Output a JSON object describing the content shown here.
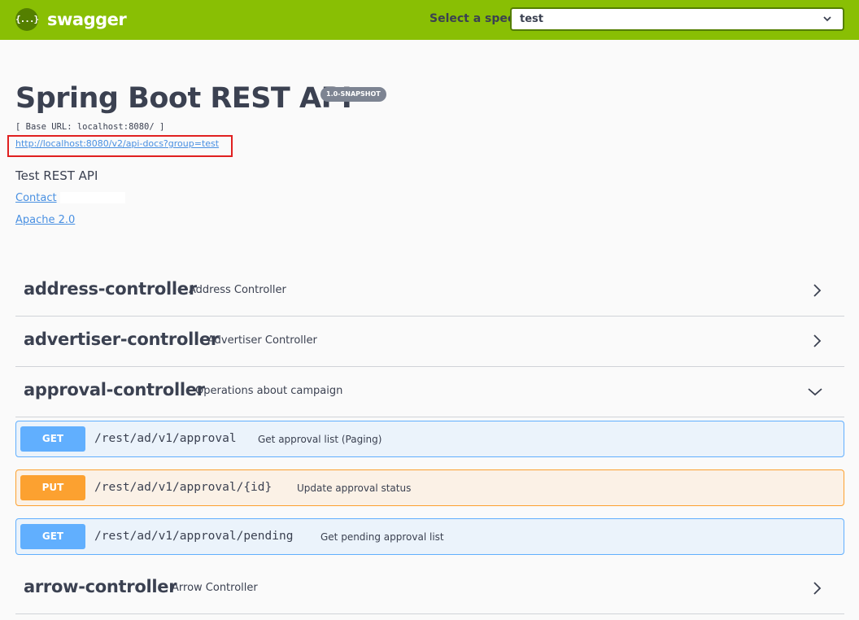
{
  "topbar": {
    "logo_text": "swagger",
    "logo_glyph": "{...}",
    "spec_label": "Select a spec",
    "spec_value": "test",
    "bg_color": "#89bf04"
  },
  "info": {
    "title": "Spring Boot REST API",
    "version": "1.0-SNAPSHOT",
    "base_url": "[ Base URL: localhost:8080/ ]",
    "api_docs_url": "http://localhost:8080/v2/api-docs?group=test",
    "description": "Test REST API",
    "contact": "Contact",
    "license": "Apache 2.0"
  },
  "controllers": [
    {
      "name": "address-controller",
      "description": "Address Controller",
      "expanded": false
    },
    {
      "name": "advertiser-controller",
      "description": "Advertiser Controller",
      "expanded": false
    },
    {
      "name": "approval-controller",
      "description": "Operations about campaign",
      "expanded": true
    },
    {
      "name": "arrow-controller",
      "description": "Arrow Controller",
      "expanded": false
    }
  ],
  "operations": [
    {
      "method": "GET",
      "path": "/rest/ad/v1/approval",
      "summary": "Get approval list (Paging)",
      "color": "#61affe"
    },
    {
      "method": "PUT",
      "path": "/rest/ad/v1/approval/{id}",
      "summary": "Update approval status",
      "color": "#fca130"
    },
    {
      "method": "GET",
      "path": "/rest/ad/v1/approval/pending",
      "summary": "Get pending approval list",
      "color": "#61affe"
    }
  ]
}
